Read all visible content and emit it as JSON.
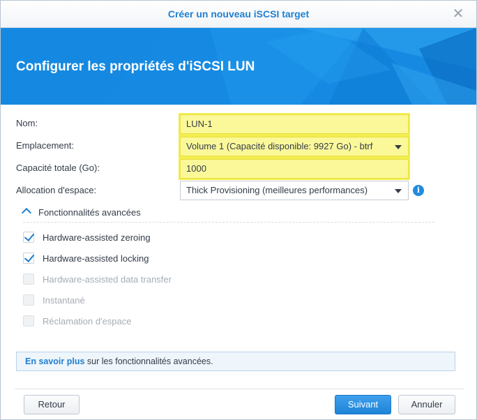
{
  "dialog": {
    "title": "Créer un nouveau iSCSI target",
    "close_glyph": "✕",
    "close_icon": "close-icon"
  },
  "banner": {
    "heading": "Configurer les propriétés d'iSCSI LUN",
    "color": "#1a8de3"
  },
  "form": {
    "name_label": "Nom:",
    "name_value": "LUN-1",
    "location_label": "Emplacement:",
    "location_value": "Volume 1 (Capacité disponible: 9927 Go) - btrf",
    "capacity_label": "Capacité totale (Go):",
    "capacity_value": "1000",
    "allocation_label": "Allocation d'espace:",
    "allocation_value": "Thick Provisioning (meilleures performances)",
    "info_icon_glyph": "i"
  },
  "advanced": {
    "toggle_label": "Fonctionnalités avancées",
    "options": [
      {
        "label": "Hardware-assisted zeroing",
        "checked": true,
        "enabled": true
      },
      {
        "label": "Hardware-assisted locking",
        "checked": true,
        "enabled": true
      },
      {
        "label": "Hardware-assisted data transfer",
        "checked": false,
        "enabled": false
      },
      {
        "label": "Instantané",
        "checked": false,
        "enabled": false
      },
      {
        "label": "Réclamation d'espace",
        "checked": false,
        "enabled": false
      }
    ]
  },
  "info_box": {
    "link_text": "En savoir plus",
    "rest_text": " sur les fonctionnalités avancées."
  },
  "footer": {
    "back_label": "Retour",
    "next_label": "Suivant",
    "cancel_label": "Annuler"
  },
  "colors": {
    "accent": "#1f7fd1",
    "highlight": "#fbf89a",
    "primary_button": "#2a8fe0"
  }
}
